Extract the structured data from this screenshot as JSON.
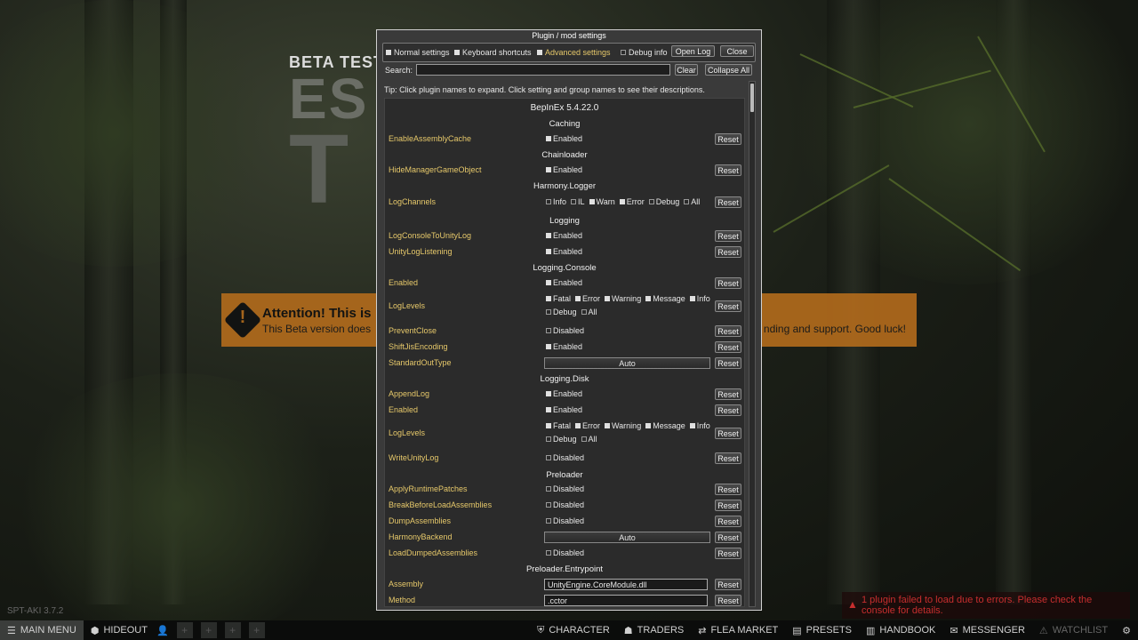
{
  "background": {
    "beta_test": "BETA TEST",
    "logo_fragment_1": "ES",
    "logo_fragment_2": "T",
    "attention_title": "Attention! This is",
    "attention_body": "This Beta version does",
    "attention_tail": "nding and support. Good luck!",
    "version": "SPT-AKI 3.7.2"
  },
  "window": {
    "title": "Plugin / mod settings",
    "toolbar": {
      "normal_settings": "Normal settings",
      "normal_settings_checked": true,
      "keyboard_shortcuts": "Keyboard shortcuts",
      "keyboard_shortcuts_checked": true,
      "advanced_settings": "Advanced settings",
      "advanced_settings_checked": true,
      "debug_info": "Debug info",
      "debug_info_checked": false,
      "open_log": "Open Log",
      "close": "Close"
    },
    "search": {
      "label": "Search:",
      "value": "",
      "clear": "Clear",
      "collapse_all": "Collapse All"
    },
    "tip": "Tip: Click plugin names to expand. Click setting and group names to see their descriptions.",
    "reset_label": "Reset",
    "plugin_title": "BepInEx 5.4.22.0",
    "groups": [
      {
        "title": "Caching"
      },
      {
        "title": "Chainloader"
      },
      {
        "title": "Harmony.Logger"
      },
      {
        "title": "Logging"
      },
      {
        "title": "Logging.Console"
      },
      {
        "title": "Logging.Disk"
      },
      {
        "title": "Preloader"
      },
      {
        "title": "Preloader.Entrypoint"
      }
    ],
    "settings": [
      {
        "name": "EnableAssemblyCache",
        "opts": [
          {
            "label": "Enabled",
            "on": true
          }
        ]
      },
      {
        "name": "HideManagerGameObject",
        "opts": [
          {
            "label": "Enabled",
            "on": true
          }
        ]
      },
      {
        "name": "LogChannels",
        "opts": [
          {
            "label": "Info",
            "on": false
          },
          {
            "label": "IL",
            "on": false
          },
          {
            "label": "Warn",
            "on": true
          },
          {
            "label": "Error",
            "on": true
          },
          {
            "label": "Debug",
            "on": false
          },
          {
            "label": "All",
            "on": false
          }
        ]
      },
      {
        "name": "LogConsoleToUnityLog",
        "opts": [
          {
            "label": "Enabled",
            "on": true
          }
        ]
      },
      {
        "name": "UnityLogListening",
        "opts": [
          {
            "label": "Enabled",
            "on": true
          }
        ]
      },
      {
        "name": "Enabled",
        "opts": [
          {
            "label": "Enabled",
            "on": true
          }
        ]
      },
      {
        "name": "LogLevels",
        "opts": [
          {
            "label": "Fatal",
            "on": true
          },
          {
            "label": "Error",
            "on": true
          },
          {
            "label": "Warning",
            "on": true
          },
          {
            "label": "Message",
            "on": true
          },
          {
            "label": "Info",
            "on": true
          }
        ],
        "opts2": [
          {
            "label": "Debug",
            "on": false
          },
          {
            "label": "All",
            "on": false
          }
        ]
      },
      {
        "name": "PreventClose",
        "opts": [
          {
            "label": "Disabled",
            "on": false
          }
        ]
      },
      {
        "name": "ShiftJisEncoding",
        "opts": [
          {
            "label": "Enabled",
            "on": true
          }
        ]
      },
      {
        "name": "StandardOutType",
        "combo": "Auto"
      },
      {
        "name": "AppendLog",
        "opts": [
          {
            "label": "Enabled",
            "on": true
          }
        ]
      },
      {
        "name": "Enabled",
        "opts": [
          {
            "label": "Enabled",
            "on": true
          }
        ]
      },
      {
        "name": "LogLevels",
        "opts": [
          {
            "label": "Fatal",
            "on": true
          },
          {
            "label": "Error",
            "on": true
          },
          {
            "label": "Warning",
            "on": true
          },
          {
            "label": "Message",
            "on": true
          },
          {
            "label": "Info",
            "on": true
          }
        ],
        "opts2": [
          {
            "label": "Debug",
            "on": false
          },
          {
            "label": "All",
            "on": false
          }
        ]
      },
      {
        "name": "WriteUnityLog",
        "opts": [
          {
            "label": "Disabled",
            "on": false
          }
        ]
      },
      {
        "name": "ApplyRuntimePatches",
        "opts": [
          {
            "label": "Disabled",
            "on": false
          }
        ]
      },
      {
        "name": "BreakBeforeLoadAssemblies",
        "opts": [
          {
            "label": "Disabled",
            "on": false
          }
        ]
      },
      {
        "name": "DumpAssemblies",
        "opts": [
          {
            "label": "Disabled",
            "on": false
          }
        ]
      },
      {
        "name": "HarmonyBackend",
        "combo": "Auto"
      },
      {
        "name": "LoadDumpedAssemblies",
        "opts": [
          {
            "label": "Disabled",
            "on": false
          }
        ]
      },
      {
        "name": "Assembly",
        "text": "UnityEngine.CoreModule.dll"
      },
      {
        "name": "Method",
        "text": ".cctor"
      }
    ]
  },
  "bottombar": {
    "main_menu": "MAIN MENU",
    "hideout": "HIDEOUT",
    "character": "CHARACTER",
    "traders": "TRADERS",
    "flea_market": "FLEA MARKET",
    "presets": "PRESETS",
    "handbook": "HANDBOOK",
    "messenger": "MESSENGER",
    "watchlist": "WATCHLIST"
  },
  "error": {
    "message": "1 plugin failed to load due to errors. Please check the console for details."
  }
}
